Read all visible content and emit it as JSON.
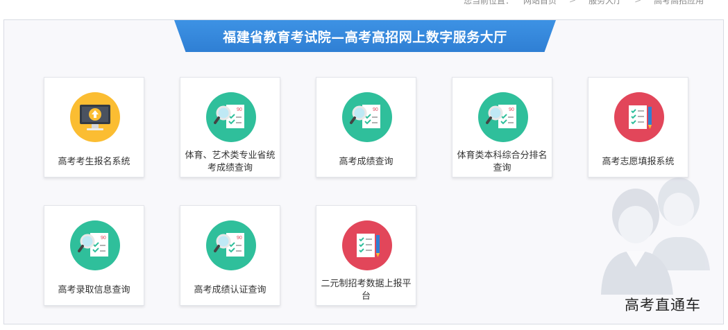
{
  "breadcrumb": {
    "prefix": "您当前位置：",
    "items": [
      "网站首页",
      "服务大厅",
      "高考高招应用"
    ]
  },
  "banner": {
    "title": "福建省教育考试院—高考高招网上数字服务大厅"
  },
  "tiles": [
    {
      "label": "高考考生报名系统",
      "icon": "computer-upload-icon",
      "color": "#fbbd32"
    },
    {
      "label": "体育、艺术类专业省统考成绩查询",
      "icon": "magnifier-score-icon",
      "color": "#2fbf9b"
    },
    {
      "label": "高考成绩查询",
      "icon": "magnifier-score-icon",
      "color": "#2fbf9b"
    },
    {
      "label": "体育类本科综合分排名查询",
      "icon": "magnifier-score-icon",
      "color": "#2fbf9b"
    },
    {
      "label": "高考志愿填报系统",
      "icon": "checklist-pencil-icon",
      "color": "#e2465a"
    },
    {
      "label": "高考录取信息查询",
      "icon": "magnifier-score-icon",
      "color": "#2fbf9b"
    },
    {
      "label": "高考成绩认证查询",
      "icon": "magnifier-score-icon",
      "color": "#2fbf9b"
    },
    {
      "label": "二元制招考数据上报平台",
      "icon": "checklist-pencil-icon",
      "color": "#e2465a"
    }
  ],
  "mascot": {
    "caption": "高考直通车"
  }
}
